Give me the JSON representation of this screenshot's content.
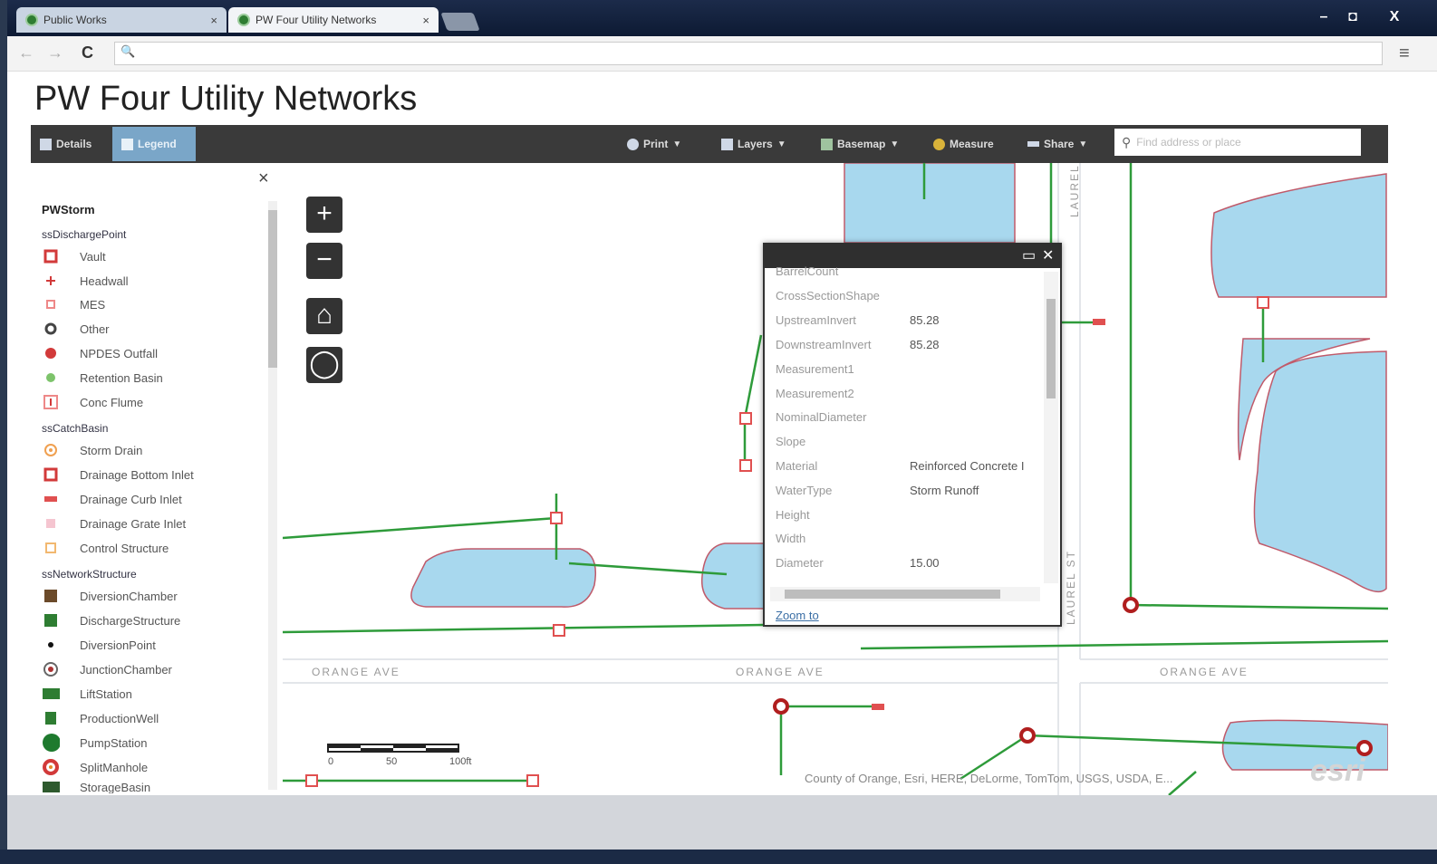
{
  "browser": {
    "tabs": [
      {
        "label": "Public Works",
        "close": "×"
      },
      {
        "label": "PW Four Utility Networks",
        "close": "×"
      }
    ],
    "window_buttons": [
      "–",
      "◘",
      "X"
    ],
    "nav": {
      "back": "←",
      "forward": "→",
      "reload": "C",
      "search": "🔍",
      "menu": "≡"
    }
  },
  "page": {
    "title": "PW Four Utility Networks"
  },
  "toolbar": {
    "details": "Details",
    "legend": "Legend",
    "print": "Print",
    "layers": "Layers",
    "basemap": "Basemap",
    "measure": "Measure",
    "share": "Share",
    "search_placeholder": "Find address or place"
  },
  "sidebar": {
    "close": "×",
    "root_layer": "PWStorm",
    "groups": [
      {
        "name": "ssDischargePoint",
        "items": [
          {
            "label": "Vault",
            "symbol": "red-square-outline"
          },
          {
            "label": "Headwall",
            "symbol": "red-plus"
          },
          {
            "label": "MES",
            "symbol": "red-small-square"
          },
          {
            "label": "Other",
            "symbol": "dark-circle"
          },
          {
            "label": "NPDES Outfall",
            "symbol": "red-dot"
          },
          {
            "label": "Retention Basin",
            "symbol": "green-dot"
          },
          {
            "label": "Conc Flume",
            "symbol": "red-square-light"
          }
        ]
      },
      {
        "name": "ssCatchBasin",
        "items": [
          {
            "label": "Storm Drain",
            "symbol": "orange-circle"
          },
          {
            "label": "Drainage Bottom Inlet",
            "symbol": "red-square-outline"
          },
          {
            "label": "Drainage Curb Inlet",
            "symbol": "red-bar"
          },
          {
            "label": "Drainage Grate Inlet",
            "symbol": "pink-square"
          },
          {
            "label": "Control Structure",
            "symbol": "orange-square"
          }
        ]
      },
      {
        "name": "ssNetworkStructure",
        "items": [
          {
            "label": "DiversionChamber",
            "symbol": "brown-square"
          },
          {
            "label": "DischargeStructure",
            "symbol": "green-square"
          },
          {
            "label": "DiversionPoint",
            "symbol": "black-dot"
          },
          {
            "label": "JunctionChamber",
            "symbol": "ring"
          },
          {
            "label": "LiftStation",
            "symbol": "green-rect"
          },
          {
            "label": "ProductionWell",
            "symbol": "green-square-small"
          },
          {
            "label": "PumpStation",
            "symbol": "green-big-dot"
          },
          {
            "label": "SplitManhole",
            "symbol": "red-ring"
          },
          {
            "label": "StorageBasin",
            "symbol": "green-rect"
          }
        ]
      }
    ]
  },
  "map_controls": {
    "zoom_in": "+",
    "zoom_out": "−",
    "home": "⌂",
    "locate": "◯"
  },
  "popup": {
    "buttons": {
      "maximize": "▭",
      "close": "✕"
    },
    "fields": [
      {
        "key": "BarrelCount",
        "value": ""
      },
      {
        "key": "CrossSectionShape",
        "value": ""
      },
      {
        "key": "UpstreamInvert",
        "value": "85.28"
      },
      {
        "key": "DownstreamInvert",
        "value": "85.28"
      },
      {
        "key": "Measurement1",
        "value": ""
      },
      {
        "key": "Measurement2",
        "value": ""
      },
      {
        "key": "NominalDiameter",
        "value": ""
      },
      {
        "key": "Slope",
        "value": ""
      },
      {
        "key": "Material",
        "value": "Reinforced Concrete I"
      },
      {
        "key": "WaterType",
        "value": "Storm Runoff"
      },
      {
        "key": "Height",
        "value": ""
      },
      {
        "key": "Width",
        "value": ""
      },
      {
        "key": "Diameter",
        "value": "15.00"
      }
    ],
    "zoom_link": "Zoom to"
  },
  "map_labels": {
    "street_orange_1": "ORANGE AVE",
    "street_orange_2": "ORANGE AVE",
    "street_orange_3": "ORANGE AVE",
    "street_laurel_top": "LAUREL",
    "street_laurel_bottom": "LAUREL ST",
    "scale_0": "0",
    "scale_50": "50",
    "scale_100": "100ft"
  },
  "attribution": "County of Orange, Esri, HERE, DeLorme, TomTom, USGS, USDA, E...",
  "esri_logo": "esri",
  "colors": {
    "toolbar": "#3a3a3a",
    "water": "#a8d8ee",
    "pipe": "#2e9b3a",
    "structure": "#d23a3a"
  }
}
